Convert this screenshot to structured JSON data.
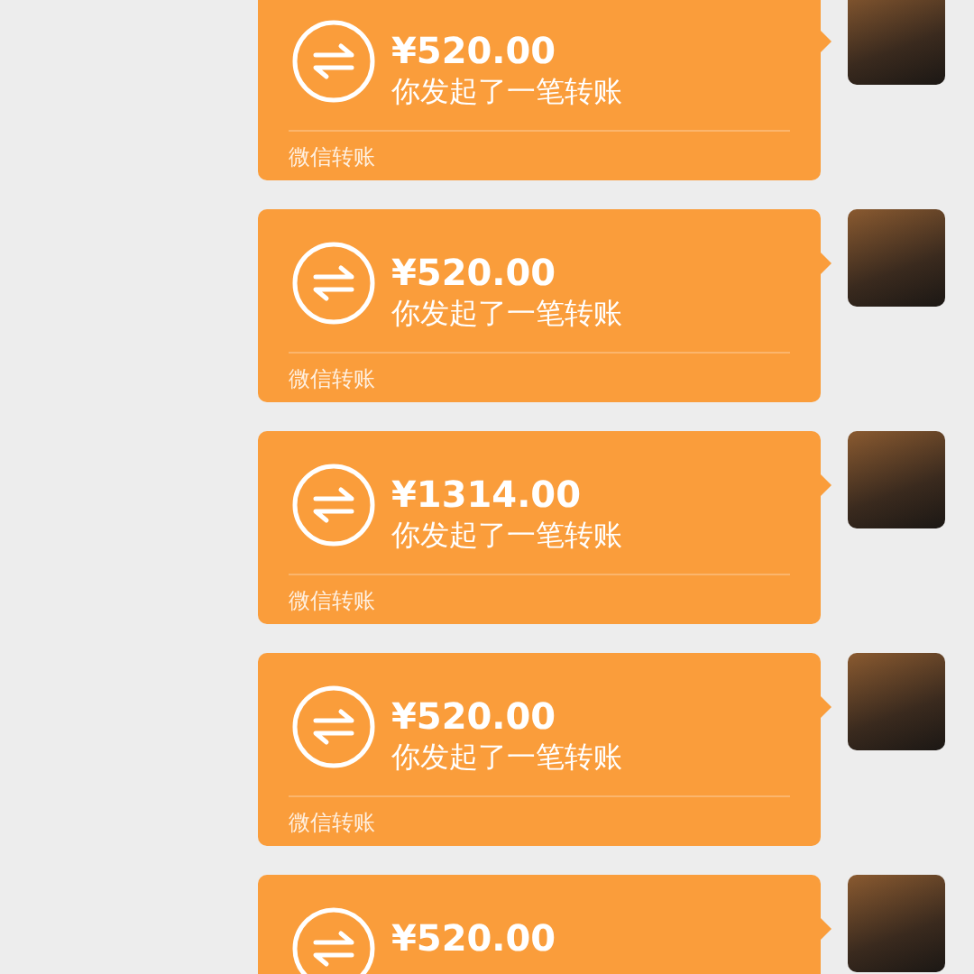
{
  "messages": [
    {
      "amount": "¥520.00",
      "note": "你发起了一笔转账",
      "footer": "微信转账"
    },
    {
      "amount": "¥520.00",
      "note": "你发起了一笔转账",
      "footer": "微信转账"
    },
    {
      "amount": "¥1314.00",
      "note": "你发起了一笔转账",
      "footer": "微信转账"
    },
    {
      "amount": "¥520.00",
      "note": "你发起了一笔转账",
      "footer": "微信转账"
    },
    {
      "amount": "¥520.00"
    }
  ]
}
